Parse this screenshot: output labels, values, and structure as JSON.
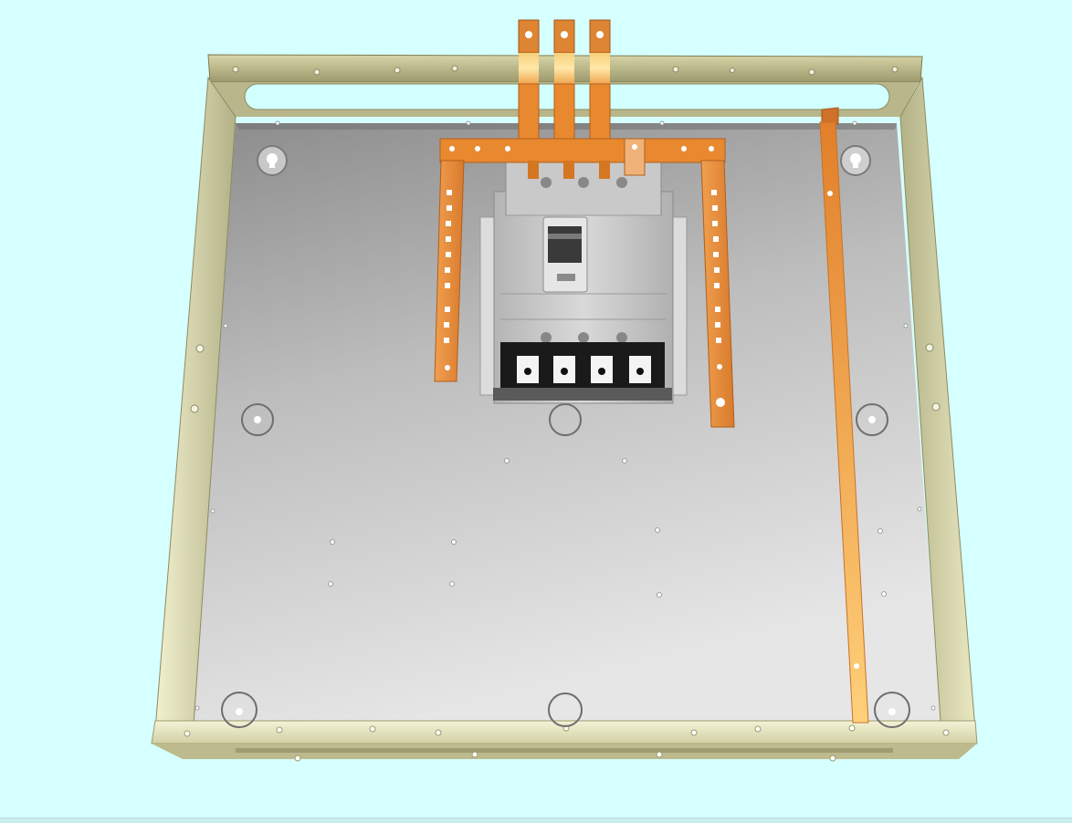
{
  "scene": {
    "description_free": true,
    "colors": {
      "background": "#d6ffff",
      "frame": "#c9c79a",
      "frame_dark": "#8f8c5e",
      "plate_light": "#e4e4e4",
      "plate_dark": "#8a8a8a",
      "copper": "#e88a3a",
      "copper_dark": "#b85c1c",
      "copper_light": "#ffd98a",
      "breaker_body": "#c8c8c8",
      "breaker_dark": "#1a1a1a"
    },
    "parts": {
      "frame": "enclosure-frame",
      "plate": "mounting-plate",
      "breaker": "circuit-breaker",
      "busbars": "copper-busbars",
      "ground_strip": "ground-strip"
    },
    "breaker_poles": 4,
    "input_terminals": 3
  }
}
